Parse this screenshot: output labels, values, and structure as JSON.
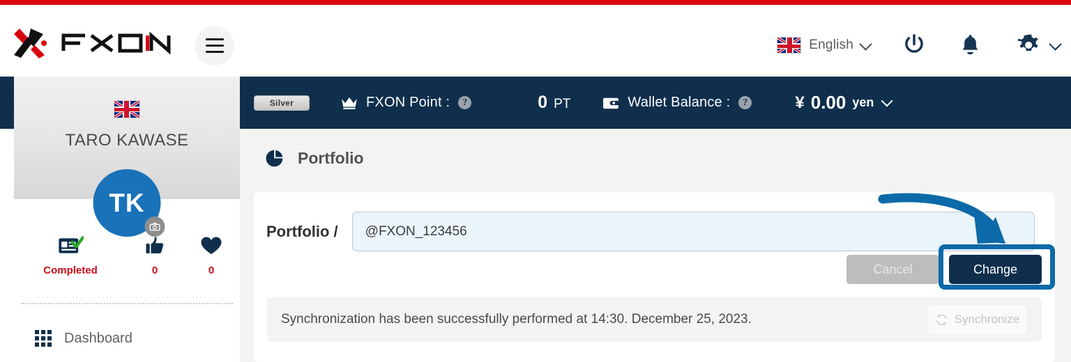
{
  "brand": {
    "logo_text": "FXON",
    "accent_red": "#d9050f",
    "navy": "#0f2f4c"
  },
  "header": {
    "menu_icon": "hamburger-icon",
    "language": {
      "label": "English",
      "flag": "uk-flag-icon",
      "chevron": "chevron-down-icon"
    },
    "power_icon": "power-icon",
    "bell_icon": "bell-notification-icon",
    "gear_icon": "gear-settings-icon",
    "gear_chevron": "chevron-down-icon"
  },
  "sidebar": {
    "flag": "uk-flag-icon",
    "user_name": "TARO KAWASE",
    "avatar_initials": "TK",
    "avatar_color": "#1a72b8",
    "camera_icon": "camera-icon",
    "stats": [
      {
        "icon": "id-card-verified-icon",
        "value": "Completed",
        "color": "#cf0a15"
      },
      {
        "icon": "thumbs-up-icon",
        "value": "0",
        "color": "#cf0a15"
      },
      {
        "icon": "heart-icon",
        "value": "0",
        "color": "#cf0a15"
      }
    ],
    "nav": [
      {
        "icon": "grid-dashboard-icon",
        "label": "Dashboard"
      }
    ]
  },
  "account_bar": {
    "rank_badge": "Silver",
    "point": {
      "icon": "crown-icon",
      "label": "FXON Point :",
      "help_icon": "help-circle-icon",
      "amount": "0",
      "unit": "PT"
    },
    "wallet": {
      "icon": "wallet-icon",
      "label": "Wallet Balance :",
      "help_icon": "help-circle-icon",
      "currency_symbol": "¥",
      "amount": "0.00",
      "unit": "yen",
      "chevron": "chevron-down-icon"
    }
  },
  "main": {
    "page_icon": "pie-chart-icon",
    "page_title": "Portfolio",
    "form": {
      "label": "Portfolio /",
      "handle_value": "@FXON_123456",
      "handle_placeholder": "@FXON_123456",
      "cancel_label": "Cancel",
      "change_label": "Change"
    },
    "sync": {
      "message": "Synchronization has been successfully performed at 14:30. December 25, 2023.",
      "button_label": "Synchronize",
      "button_icon": "refresh-sync-icon"
    }
  },
  "annotation": {
    "arrow": "curved-arrow-annotation",
    "highlight": "change-button-highlight-box",
    "color": "#0c6aa8"
  }
}
